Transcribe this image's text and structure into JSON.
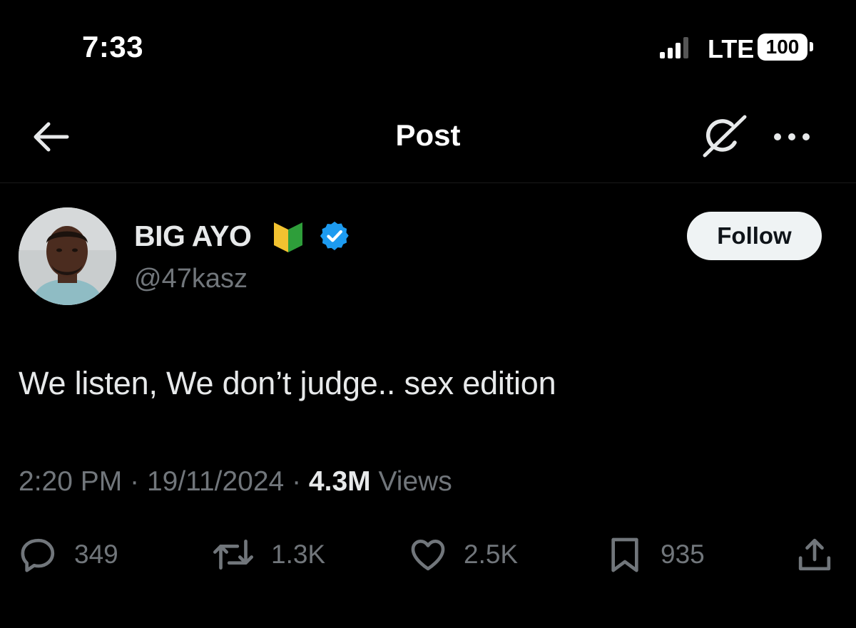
{
  "status_bar": {
    "time": "7:33",
    "network": "LTE",
    "battery": "100",
    "icons": [
      "signal-icon",
      "battery-icon"
    ]
  },
  "header": {
    "title": "Post",
    "icons": [
      "back-arrow-icon",
      "grok-icon",
      "more-options-icon"
    ]
  },
  "author": {
    "name": "BIG AYO",
    "handle": "@47kasz",
    "verified": true,
    "badge_icon": "beginner-badge-icon",
    "follow_label": "Follow"
  },
  "post": {
    "text": "We listen, We don’t judge.. sex edition",
    "time": "2:20 PM",
    "date": "19/11/2024",
    "separator": "·",
    "views": "4.3M",
    "views_label": "Views"
  },
  "actions": {
    "replies": "349",
    "reposts": "1.3K",
    "likes": "2.5K",
    "bookmarks": "935",
    "icons": [
      "reply-icon",
      "repost-icon",
      "like-icon",
      "bookmark-icon",
      "share-icon"
    ]
  },
  "colors": {
    "background": "#000000",
    "primary_text": "#e7e9ea",
    "secondary_text": "#71767b",
    "verified_blue": "#1d9bf0",
    "follow_button_bg": "#eff3f4",
    "badge_green": "#2e9e3a",
    "badge_yellow": "#f2c230"
  }
}
